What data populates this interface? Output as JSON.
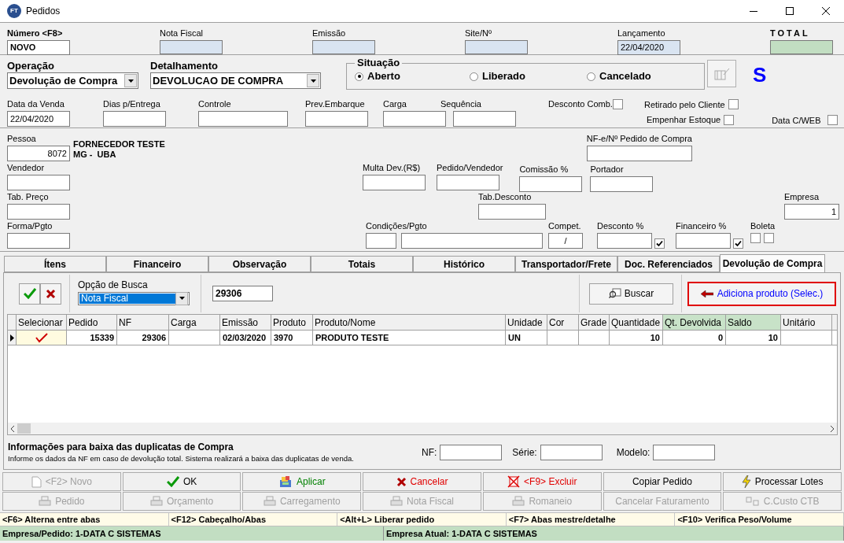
{
  "window": {
    "logo": "FT",
    "title": "Pedidos"
  },
  "header": [
    {
      "label": "Número <F8>",
      "value": "NOVO",
      "kind": "editable"
    },
    {
      "label": "Nota Fiscal",
      "kind": "readonly"
    },
    {
      "label": "Emissão",
      "kind": "readonly"
    },
    {
      "label": "Site/Nº",
      "kind": "readonly"
    },
    {
      "label": "Lançamento",
      "value": "22/04/2020",
      "kind": "readonly"
    },
    {
      "label": "TOTAL",
      "kind": "total"
    }
  ],
  "operacao": {
    "label": "Operação",
    "value": "Devolução de Compra"
  },
  "detalhamento": {
    "label": "Detalhamento",
    "value": "DEVOLUCAO DE COMPRA"
  },
  "situacao": {
    "title": "Situação",
    "options": [
      {
        "label": "Aberto",
        "selected": true
      },
      {
        "label": "Liberado",
        "selected": false
      },
      {
        "label": "Cancelado",
        "selected": false
      }
    ]
  },
  "status_letter": "S",
  "row3": [
    {
      "label": "Data da Venda",
      "value": "22/04/2020"
    },
    {
      "label": "Dias p/Entrega"
    },
    {
      "label": "Controle"
    },
    {
      "label": "Prev.Embarque"
    },
    {
      "label": "Carga"
    },
    {
      "label": "Sequência"
    }
  ],
  "flags": [
    {
      "label": "Desconto Comb.",
      "checked": false
    },
    {
      "label": "Retirado pelo Cliente",
      "checked": false
    },
    {
      "label": "Empenhar Estoque",
      "checked": false
    },
    {
      "label": "Data C/WEB",
      "checked": false
    }
  ],
  "pessoa": {
    "label": "Pessoa",
    "value": "8072",
    "name": "FORNECEDOR TESTE",
    "place": "MG -  UBA"
  },
  "fields": {
    "nfe": {
      "label": "NF-e/Nº Pedido de Compra"
    },
    "vendedor": {
      "label": "Vendedor"
    },
    "multa": {
      "label": "Multa Dev.(R$)"
    },
    "pedido_vendedor": {
      "label": "Pedido/Vendedor"
    },
    "comissao": {
      "label": "Comissão %"
    },
    "portador": {
      "label": "Portador"
    },
    "tab_preco": {
      "label": "Tab. Preço"
    },
    "tab_desconto": {
      "label": "Tab.Desconto"
    },
    "empresa": {
      "label": "Empresa",
      "value": "1"
    },
    "forma_pgto": {
      "label": "Forma/Pgto"
    },
    "condicoes": {
      "label": "Condições/Pgto"
    },
    "compet": {
      "label": "Compet.",
      "value": "/"
    }
  },
  "desconto": {
    "label": "Desconto %",
    "checked": true
  },
  "financeiro": {
    "label": "Financeiro %",
    "checked": true
  },
  "boleta": {
    "label": "Boleta",
    "checks": [
      {
        "checked": false
      },
      {
        "checked": false
      }
    ]
  },
  "tabs": [
    {
      "label": "Ítens",
      "selected": false
    },
    {
      "label": "Financeiro",
      "selected": false
    },
    {
      "label": "Observação",
      "selected": false
    },
    {
      "label": "Totais",
      "selected": false
    },
    {
      "label": "Histórico",
      "selected": false
    },
    {
      "label": "Transportador/Frete",
      "selected": false
    },
    {
      "label": "Doc. Referenciados",
      "selected": false
    },
    {
      "label": "Devolução de Compra",
      "selected": true
    }
  ],
  "busca": {
    "label": "Opção de Busca",
    "option": "Nota Fiscal",
    "value": "29306",
    "search_button": "Buscar",
    "add_button": "Adiciona produto (Selec.)"
  },
  "grid": {
    "columns": [
      {
        "label": "Selecionar",
        "highlight": false
      },
      {
        "label": "Pedido",
        "highlight": false
      },
      {
        "label": "NF",
        "highlight": false
      },
      {
        "label": "Carga",
        "highlight": false
      },
      {
        "label": "Emissão",
        "highlight": false
      },
      {
        "label": "Produto",
        "highlight": false
      },
      {
        "label": "Produto/Nome",
        "highlight": false
      },
      {
        "label": "Unidade",
        "highlight": false
      },
      {
        "label": "Cor",
        "highlight": false
      },
      {
        "label": "Grade",
        "highlight": false
      },
      {
        "label": "Quantidade",
        "highlight": false
      },
      {
        "label": "Qt. Devolvida",
        "highlight": true
      },
      {
        "label": "Saldo",
        "highlight": true
      },
      {
        "label": "Unitário",
        "highlight": false
      }
    ],
    "rows": [
      {
        "current": true,
        "checked": true,
        "pedido": "15339",
        "nf": "29306",
        "emissao": "02/03/2020",
        "produto": "3970",
        "nome": "PRODUTO TESTE",
        "unidade": "UN",
        "quantidade": "10",
        "qt_devolvida": "0",
        "saldo": "10"
      }
    ]
  },
  "baixa": {
    "title": "Informações para baixa das duplicatas de Compra",
    "note": "Informe os dados da NF em caso de devolução total. Sistema realizará a baixa das duplicatas de venda.",
    "fields": [
      {
        "label": "NF:"
      },
      {
        "label": "Série:"
      },
      {
        "label": "Modelo:"
      }
    ]
  },
  "buttons": [
    [
      {
        "label": "<F2> Novo",
        "disabled": true
      },
      {
        "label": "OK",
        "disabled": false,
        "kind": "plain"
      },
      {
        "label": "Aplicar",
        "disabled": false,
        "kind": "green"
      },
      {
        "label": "Cancelar",
        "disabled": false,
        "kind": "red"
      },
      {
        "label": "<F9> Excluir",
        "disabled": false,
        "kind": "red"
      },
      {
        "label": "Copiar Pedido",
        "disabled": false,
        "kind": "plain"
      },
      {
        "label": "Processar Lotes",
        "disabled": false,
        "kind": "plain"
      }
    ],
    [
      {
        "label": "Pedido",
        "disabled": true
      },
      {
        "label": "Orçamento",
        "disabled": true
      },
      {
        "label": "Carregamento",
        "disabled": true
      },
      {
        "label": "Nota Fiscal",
        "disabled": true
      },
      {
        "label": "Romaneio",
        "disabled": true
      },
      {
        "label": "Cancelar Faturamento",
        "disabled": true
      },
      {
        "label": "C.Custo CTB",
        "disabled": true
      }
    ]
  ],
  "shortcuts": [
    "<F6> Alterna entre abas",
    "<F12> Cabeçalho/Abas",
    "<Alt+L> Liberar pedido",
    "<F7> Abas mestre/detalhe",
    "<F10> Verifica Peso/Volume"
  ],
  "status_bar": [
    "Empresa/Pedido: 1-DATA C SISTEMAS",
    "Empresa Atual: 1-DATA C SISTEMAS"
  ]
}
